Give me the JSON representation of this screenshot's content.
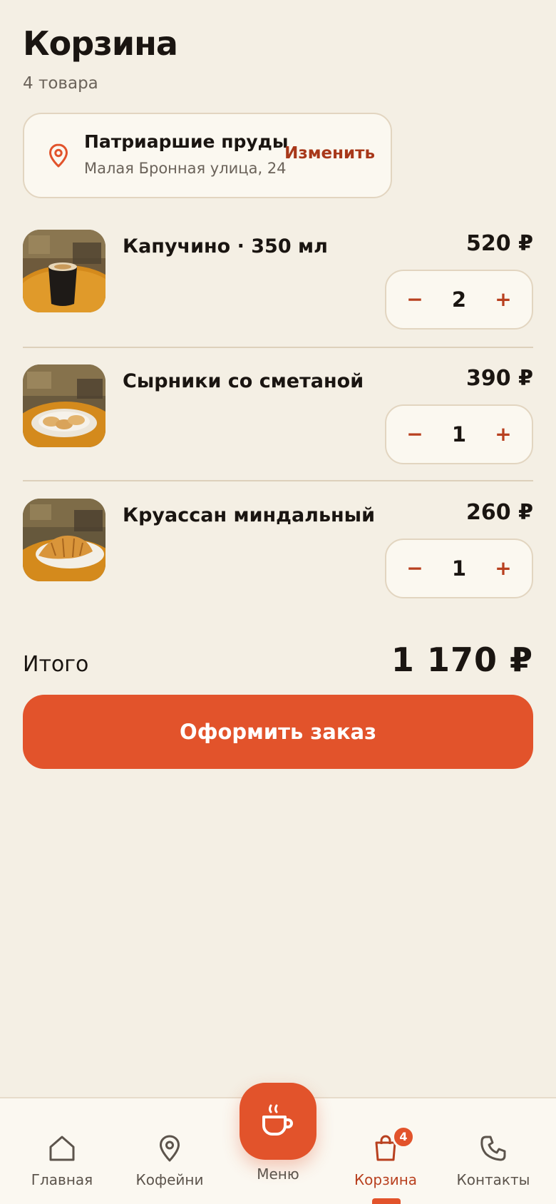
{
  "header": {
    "title": "Корзина",
    "subtitle": "4 товара"
  },
  "address": {
    "icon": "location-pin-icon",
    "name": "Патриаршие пруды",
    "street": "Малая Бронная улица, 24",
    "change_label": "Изменить"
  },
  "items": [
    {
      "name": "Капучино · 350 мл",
      "price": "520 ₽",
      "qty": "2",
      "minus": "−",
      "plus": "+",
      "image": "cappuccino-photo"
    },
    {
      "name": "Сырники со сметаной",
      "price": "390 ₽",
      "qty": "1",
      "minus": "−",
      "plus": "+",
      "image": "syrniki-photo"
    },
    {
      "name": "Круассан миндальный",
      "price": "260 ₽",
      "qty": "1",
      "minus": "−",
      "plus": "+",
      "image": "croissant-photo"
    }
  ],
  "summary": {
    "total_label": "Итого",
    "total_value": "1 170 ₽"
  },
  "checkout": {
    "label": "Оформить заказ"
  },
  "tabbar": {
    "tabs": [
      {
        "label": "Главная",
        "icon": "home-icon"
      },
      {
        "label": "Кофейни",
        "icon": "location-pin-icon"
      },
      {
        "label": "Меню",
        "icon": "coffee-cup-icon"
      },
      {
        "label": "Корзина",
        "icon": "shopping-bag-icon",
        "badge": "4"
      },
      {
        "label": "Контакты",
        "icon": "phone-icon"
      }
    ]
  },
  "colors": {
    "accent": "#e2532b",
    "accent_dark": "#a8381a",
    "background": "#f4efe4",
    "card": "#fbf8f0"
  }
}
